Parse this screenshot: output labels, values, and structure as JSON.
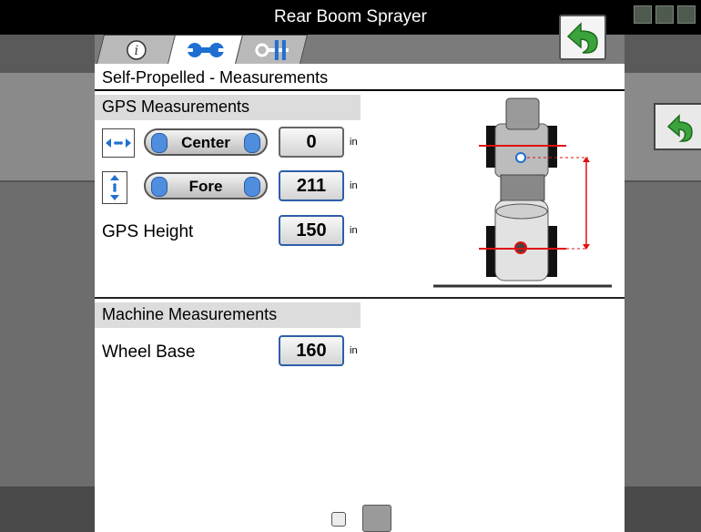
{
  "window": {
    "title": "Rear Boom Sprayer"
  },
  "screen": {
    "header": "Self-Propelled - Measurements",
    "tabs": [
      {
        "icon": "info-icon"
      },
      {
        "icon": "wrench-icon"
      },
      {
        "icon": "key-icon"
      }
    ],
    "gps": {
      "section": "GPS Measurements",
      "lateral": {
        "direction": "Center",
        "value": "0",
        "unit": "in"
      },
      "inline": {
        "direction": "Fore",
        "value": "211",
        "unit": "in"
      },
      "height": {
        "label": "GPS Height",
        "value": "150",
        "unit": "in"
      }
    },
    "machine": {
      "section": "Machine Measurements",
      "wheel_base": {
        "label": "Wheel Base",
        "value": "160",
        "unit": "in"
      }
    }
  },
  "colors": {
    "accent_green": "#3ba33b",
    "measure_red": "#e01010",
    "select_blue": "#2e5fa8"
  }
}
